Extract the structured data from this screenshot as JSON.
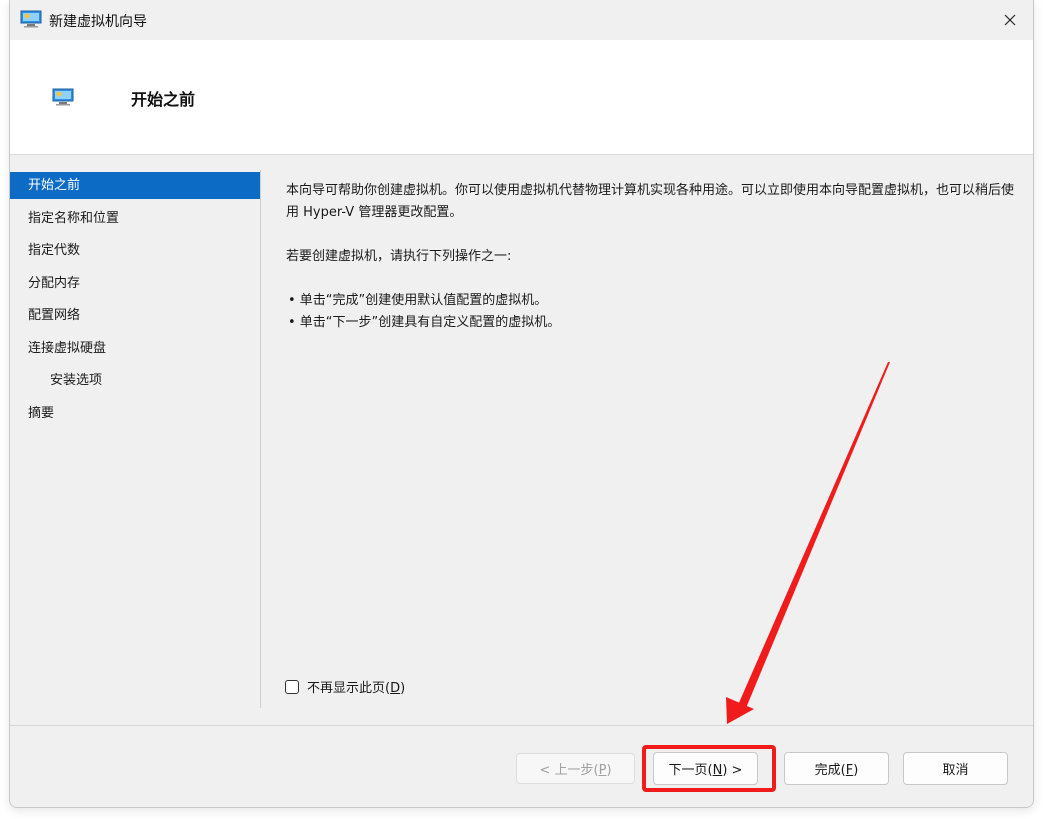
{
  "window": {
    "title": "新建虚拟机向导",
    "close_icon": "close-icon"
  },
  "header": {
    "title": "开始之前"
  },
  "nav": {
    "items": [
      {
        "label": "开始之前",
        "selected": true
      },
      {
        "label": "指定名称和位置"
      },
      {
        "label": "指定代数"
      },
      {
        "label": "分配内存"
      },
      {
        "label": "配置网络"
      },
      {
        "label": "连接虚拟硬盘"
      },
      {
        "label": "安装选项",
        "indent": true
      },
      {
        "label": "摘要"
      }
    ]
  },
  "content": {
    "intro": "本向导可帮助你创建虚拟机。你可以使用虚拟机代替物理计算机实现各种用途。可以立即使用本向导配置虚拟机，也可以稍后使用 Hyper-V 管理器更改配置。",
    "instruction": "若要创建虚拟机，请执行下列操作之一:",
    "bullets": [
      "• 单击“完成”创建使用默认值配置的虚拟机。",
      "• 单击“下一步”创建具有自定义配置的虚拟机。"
    ]
  },
  "checkbox": {
    "label_prefix": "不再显示此页(",
    "label_key": "D",
    "label_suffix": ")",
    "checked": false
  },
  "buttons": {
    "prev": {
      "prefix": "< 上一步(",
      "key": "P",
      "suffix": ")",
      "disabled": true
    },
    "next": {
      "prefix": "下一页(",
      "key": "N",
      "suffix": ") >"
    },
    "finish": {
      "prefix": "完成(",
      "key": "F",
      "suffix": ")"
    },
    "cancel": {
      "label": "取消"
    }
  },
  "annotation": {
    "highlight_color": "#f01c1c"
  },
  "colors": {
    "accent": "#0c6bc4",
    "window_bg": "#f0f0f0",
    "panel_bg": "#ffffff"
  }
}
